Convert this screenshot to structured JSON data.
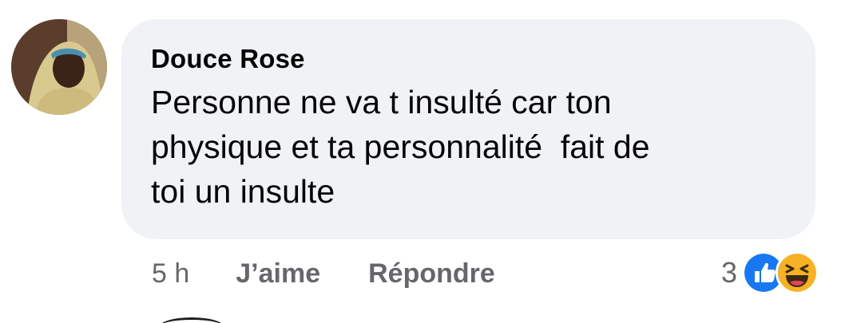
{
  "comment": {
    "author": "Douce Rose",
    "text": "Personne ne va t insulté car ton\nphysique et ta personnalité  fait de\ntoi un insulte",
    "time": "5 h",
    "like_label": "J’aime",
    "reply_label": "Répondre",
    "reaction_count": "3",
    "reactions": [
      "like-icon",
      "haha-icon"
    ]
  },
  "colors": {
    "bubble_bg": "#f0f2f5",
    "text": "#050505",
    "meta": "#65676b",
    "like_blue": "#1877f2",
    "haha_yellow": "#f7b125"
  }
}
